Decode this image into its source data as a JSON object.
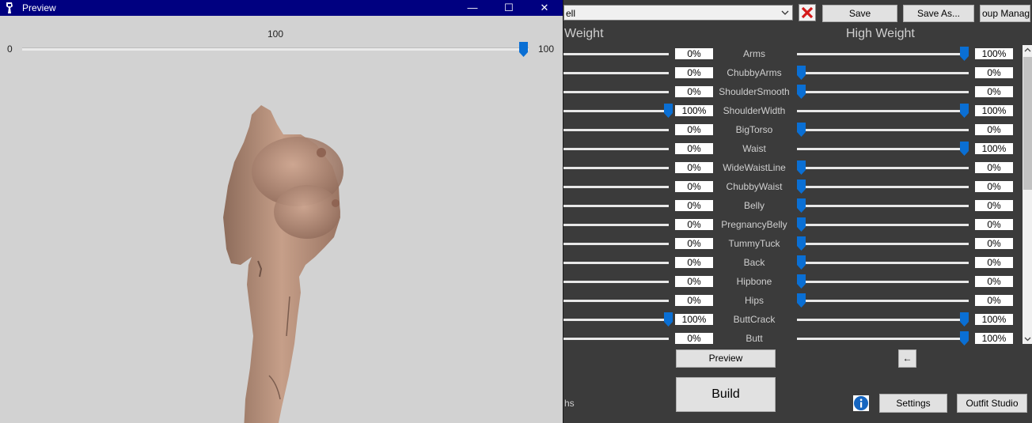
{
  "preview_window": {
    "title": "Preview",
    "weight_value": "100",
    "slider_min": "0",
    "slider_max": "100",
    "slider_level": 1.0,
    "controls": {
      "minimize": "—",
      "maximize": "☐",
      "close": "✕"
    }
  },
  "toolbar": {
    "preset_value": "ell",
    "save_label": "Save",
    "save_as_label": "Save As...",
    "group_manager_label": "oup Manag"
  },
  "headers": {
    "low": "Weight",
    "high": "High Weight"
  },
  "sliders": [
    {
      "name": "Arms",
      "low": "0%",
      "high": "100%",
      "low_level": 0,
      "high_level": 1
    },
    {
      "name": "ChubbyArms",
      "low": "0%",
      "high": "0%",
      "low_level": 0,
      "high_level": 0
    },
    {
      "name": "ShoulderSmooth",
      "low": "0%",
      "high": "0%",
      "low_level": 0,
      "high_level": 0
    },
    {
      "name": "ShoulderWidth",
      "low": "100%",
      "high": "100%",
      "low_level": 1,
      "high_level": 1
    },
    {
      "name": "BigTorso",
      "low": "0%",
      "high": "0%",
      "low_level": 0,
      "high_level": 0
    },
    {
      "name": "Waist",
      "low": "0%",
      "high": "100%",
      "low_level": 0,
      "high_level": 1
    },
    {
      "name": "WideWaistLine",
      "low": "0%",
      "high": "0%",
      "low_level": 0,
      "high_level": 0
    },
    {
      "name": "ChubbyWaist",
      "low": "0%",
      "high": "0%",
      "low_level": 0,
      "high_level": 0
    },
    {
      "name": "Belly",
      "low": "0%",
      "high": "0%",
      "low_level": 0,
      "high_level": 0
    },
    {
      "name": "PregnancyBelly",
      "low": "0%",
      "high": "0%",
      "low_level": 0,
      "high_level": 0
    },
    {
      "name": "TummyTuck",
      "low": "0%",
      "high": "0%",
      "low_level": 0,
      "high_level": 0
    },
    {
      "name": "Back",
      "low": "0%",
      "high": "0%",
      "low_level": 0,
      "high_level": 0
    },
    {
      "name": "Hipbone",
      "low": "0%",
      "high": "0%",
      "low_level": 0,
      "high_level": 0
    },
    {
      "name": "Hips",
      "low": "0%",
      "high": "0%",
      "low_level": 0,
      "high_level": 0
    },
    {
      "name": "ButtCrack",
      "low": "100%",
      "high": "100%",
      "low_level": 1,
      "high_level": 1
    },
    {
      "name": "Butt",
      "low": "0%",
      "high": "100%",
      "low_level": 0,
      "high_level": 1
    }
  ],
  "buttons": {
    "preview": "Preview",
    "back_arrow": "←",
    "build": "Build",
    "settings": "Settings",
    "outfit_studio": "Outfit Studio"
  },
  "footer_fragment": "hs",
  "icons": {
    "delete": "x-icon",
    "info": "info-icon",
    "app": "app-icon"
  },
  "colors": {
    "titlebar": "#000080",
    "panel_bg": "#3b3b3b",
    "preview_bg": "#d2d2d2",
    "thumb": "#0a6fd4",
    "delete_x": "#d41a1a"
  }
}
